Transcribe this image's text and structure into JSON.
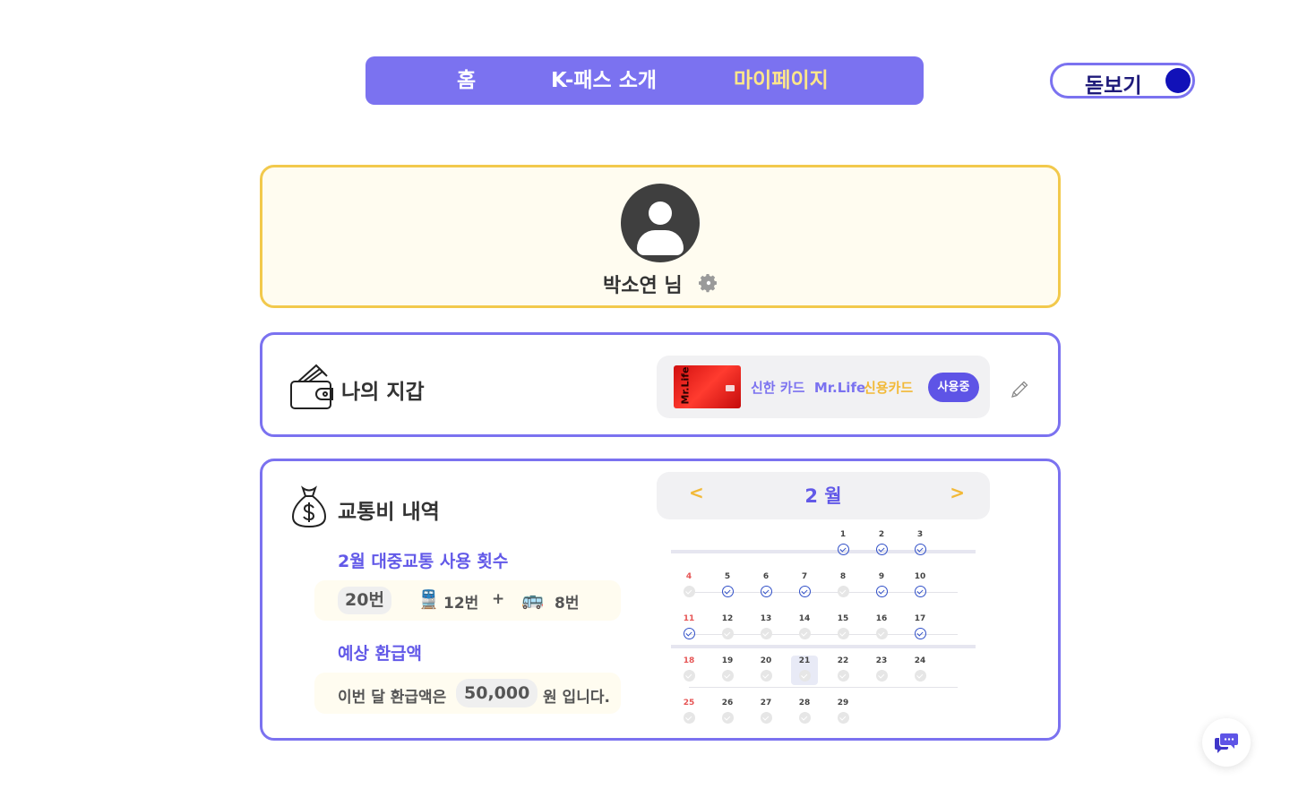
{
  "nav": {
    "items": [
      {
        "label": "홈",
        "active": false
      },
      {
        "label": "K-패스 소개",
        "active": false
      },
      {
        "label": "마이페이지",
        "active": true
      }
    ],
    "magnifier_label": "돋보기"
  },
  "profile": {
    "name": "박소연 님",
    "icons": [
      "avatar",
      "gear-icon"
    ]
  },
  "wallet": {
    "title": "나의 지갑",
    "card": {
      "image_text": "Mr.Life",
      "bank_and_name": "신한 카드  Mr.Life",
      "type": "신용카드",
      "status": "사용중"
    },
    "icons": [
      "wallet-icon",
      "pencil-icon"
    ]
  },
  "fare": {
    "title": "교통비 내역",
    "usage_label": "2월 대중교통 사용 횟수",
    "usage_total": "20번",
    "train_count": "12번",
    "plus": "+",
    "bus_count": "8번",
    "refund_label": "예상 환급액",
    "refund_pre": "이번 달 환급액은",
    "refund_amount": "50,000",
    "refund_post": "원 입니다.",
    "icons": [
      "money-bag-icon",
      "train-icon",
      "bus-icon"
    ]
  },
  "calendar": {
    "prev": "<",
    "next": ">",
    "month": "2 월",
    "today": 21,
    "days": [
      {
        "d": "1",
        "used": true
      },
      {
        "d": "2",
        "used": true
      },
      {
        "d": "3",
        "used": true
      },
      {
        "d": "4",
        "used": false,
        "sun": true
      },
      {
        "d": "5",
        "used": true
      },
      {
        "d": "6",
        "used": true
      },
      {
        "d": "7",
        "used": true
      },
      {
        "d": "8",
        "used": false
      },
      {
        "d": "9",
        "used": true
      },
      {
        "d": "10",
        "used": true
      },
      {
        "d": "11",
        "used": true,
        "sun": true
      },
      {
        "d": "12",
        "used": false
      },
      {
        "d": "13",
        "used": false
      },
      {
        "d": "14",
        "used": false
      },
      {
        "d": "15",
        "used": false
      },
      {
        "d": "16",
        "used": false
      },
      {
        "d": "17",
        "used": true
      },
      {
        "d": "18",
        "used": false,
        "sun": true
      },
      {
        "d": "19",
        "used": false
      },
      {
        "d": "20",
        "used": false
      },
      {
        "d": "21",
        "used": false
      },
      {
        "d": "22",
        "used": false
      },
      {
        "d": "23",
        "used": false
      },
      {
        "d": "24",
        "used": false
      },
      {
        "d": "25",
        "used": false,
        "sun": true
      },
      {
        "d": "26",
        "used": false
      },
      {
        "d": "27",
        "used": false
      },
      {
        "d": "28",
        "used": false
      },
      {
        "d": "29",
        "used": false
      }
    ]
  },
  "colors": {
    "primary": "#7B72F0",
    "accent_yellow": "#F2C94C",
    "active_nav": "#FDE68A",
    "check_blue": "#3150C8"
  },
  "chat": {
    "icon": "chat-icon"
  }
}
